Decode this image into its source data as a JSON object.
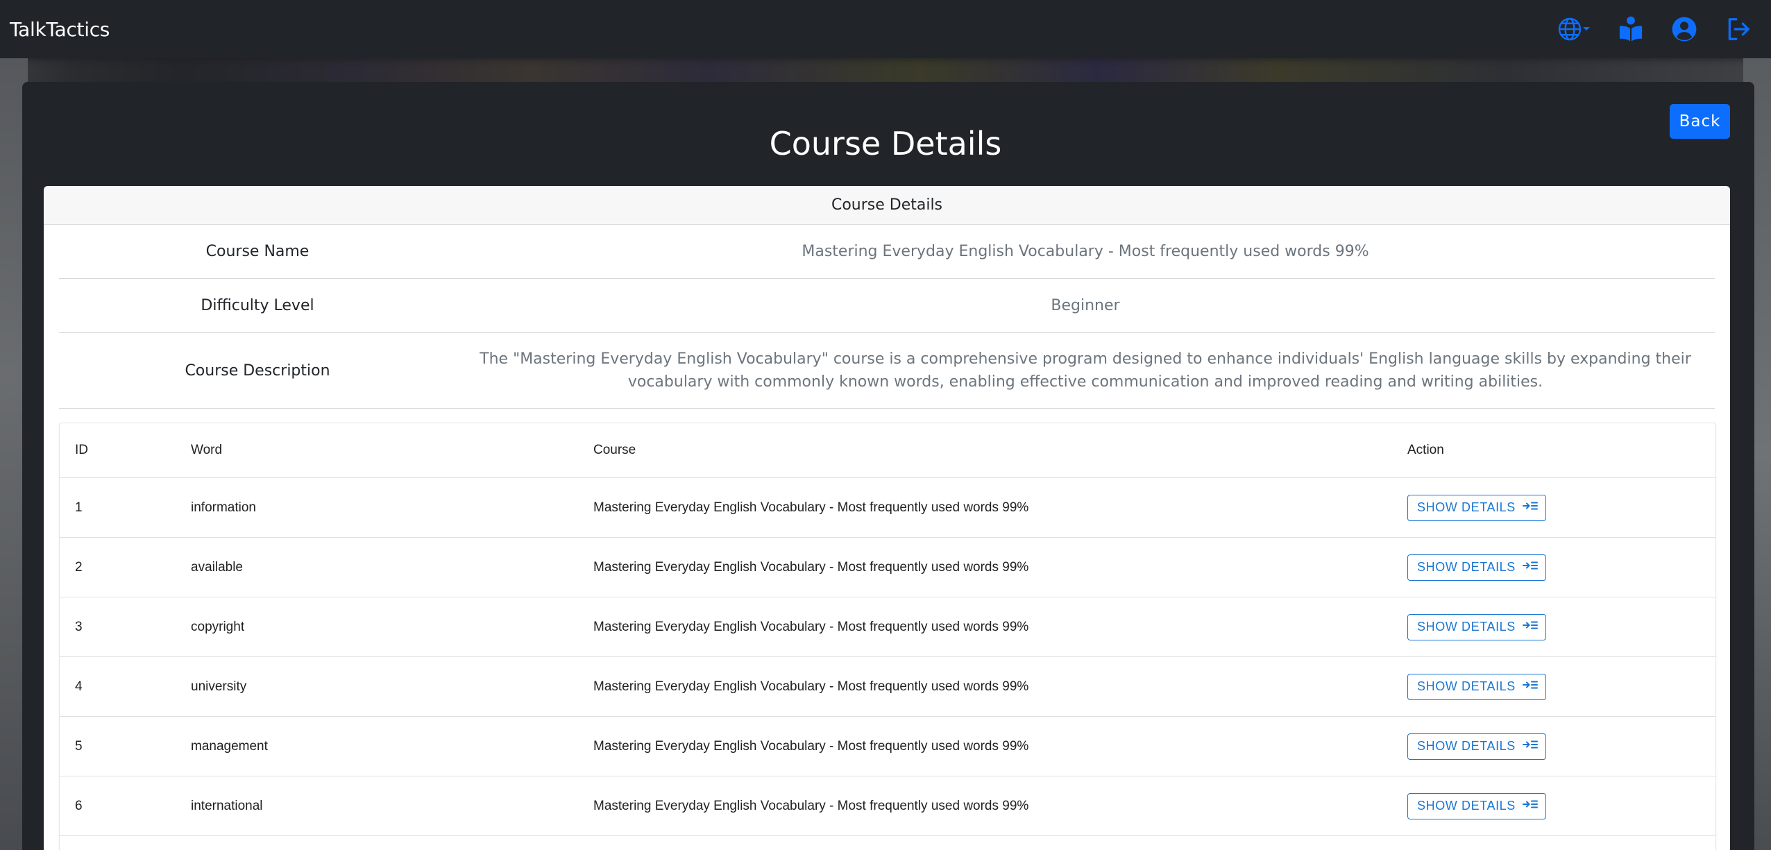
{
  "app": {
    "brand": "TalkTactics"
  },
  "navbar": {
    "icons": [
      "globe-icon",
      "reading-book-icon",
      "user-circle-icon",
      "logout-icon"
    ],
    "accent_color": "#0d6efd"
  },
  "page": {
    "title": "Course Details",
    "back_label": "Back"
  },
  "card": {
    "header": "Course Details",
    "fields": [
      {
        "label": "Course Name",
        "value": "Mastering Everyday English Vocabulary - Most frequently used words 99%"
      },
      {
        "label": "Difficulty Level",
        "value": "Beginner"
      },
      {
        "label": "Course Description",
        "value": "The \"Mastering Everyday English Vocabulary\" course is a comprehensive program designed to enhance individuals' English language skills by expanding their vocabulary with commonly known words, enabling effective communication and improved reading and writing abilities."
      }
    ]
  },
  "words_table": {
    "columns": [
      "ID",
      "Word",
      "Course",
      "Action"
    ],
    "action_label": "SHOW DETAILS",
    "rows": [
      {
        "id": "1",
        "word": "information",
        "course": "Mastering Everyday English Vocabulary - Most frequently used words 99%"
      },
      {
        "id": "2",
        "word": "available",
        "course": "Mastering Everyday English Vocabulary - Most frequently used words 99%"
      },
      {
        "id": "3",
        "word": "copyright",
        "course": "Mastering Everyday English Vocabulary - Most frequently used words 99%"
      },
      {
        "id": "4",
        "word": "university",
        "course": "Mastering Everyday English Vocabulary - Most frequently used words 99%"
      },
      {
        "id": "5",
        "word": "management",
        "course": "Mastering Everyday English Vocabulary - Most frequently used words 99%"
      },
      {
        "id": "6",
        "word": "international",
        "course": "Mastering Everyday English Vocabulary - Most frequently used words 99%"
      }
    ]
  }
}
